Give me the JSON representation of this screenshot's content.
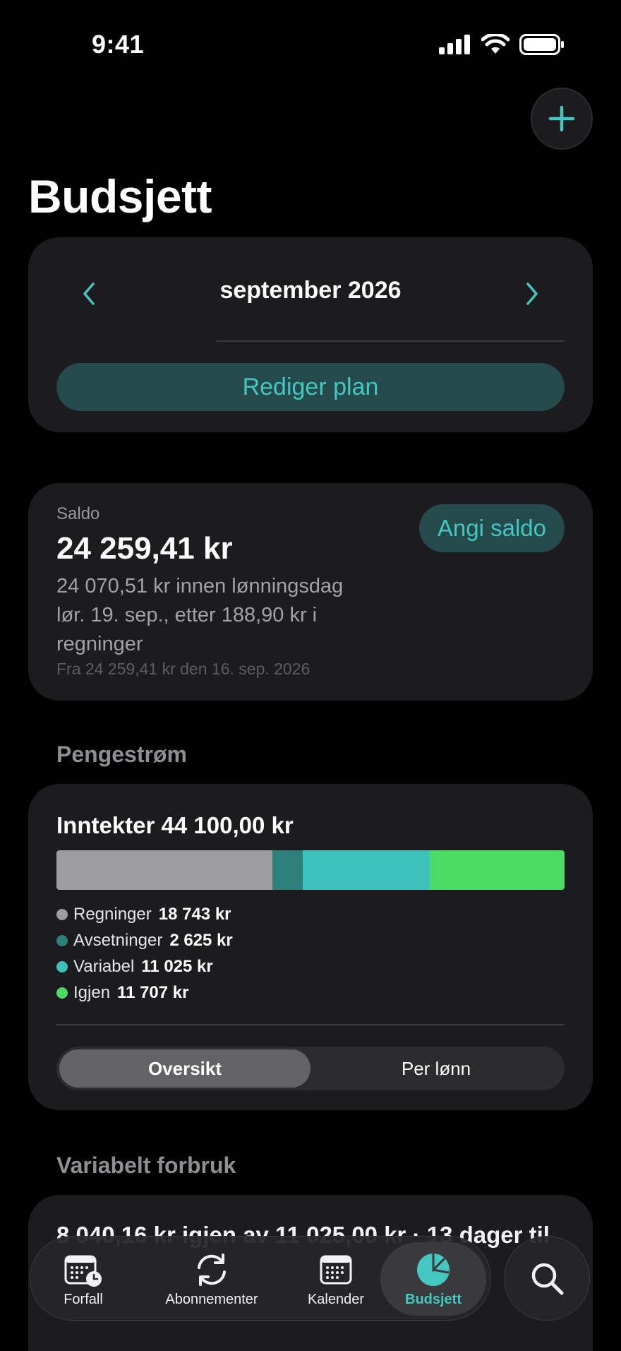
{
  "status_bar": {
    "time": "9:41"
  },
  "page": {
    "title": "Budsjett"
  },
  "month_selector": {
    "label": "september 2026",
    "edit_button": "Rediger plan"
  },
  "saldo": {
    "label": "Saldo",
    "amount": "24 259,41 kr",
    "description": "24 070,51 kr innen lønningsdag lør. 19. sep., etter 188,90 kr i regninger",
    "from_text": "Fra 24 259,41 kr den 16. sep. 2026",
    "set_button": "Angi saldo"
  },
  "cashflow": {
    "section_title": "Pengestrøm",
    "title": "Inntekter 44 100,00 kr",
    "total": 44100,
    "items": [
      {
        "name": "Regninger",
        "value_text": "18 743 kr",
        "value": 18743,
        "color": "#9c9ca1"
      },
      {
        "name": "Avsetninger",
        "value_text": "2 625 kr",
        "value": 2625,
        "color": "#2e7f7a"
      },
      {
        "name": "Variabel",
        "value_text": "11 025 kr",
        "value": 11025,
        "color": "#3ec1bb"
      },
      {
        "name": "Igjen",
        "value_text": "11 707 kr",
        "value": 11707,
        "color": "#4cd964"
      }
    ],
    "segments": [
      "Oversikt",
      "Per lønn"
    ],
    "active_segment": 0
  },
  "variable_spending": {
    "section_title": "Variabelt forbruk",
    "summary": "8 040,16 kr igjen av 11 025,00 kr · 13 dager til"
  },
  "tabbar": {
    "tabs": [
      "Forfall",
      "Abonnementer",
      "Kalender",
      "Budsjett"
    ],
    "active": 3
  },
  "colors": {
    "accent": "#45c7c1",
    "accent_bg": "#244a4b",
    "card": "#1c1c1e"
  }
}
